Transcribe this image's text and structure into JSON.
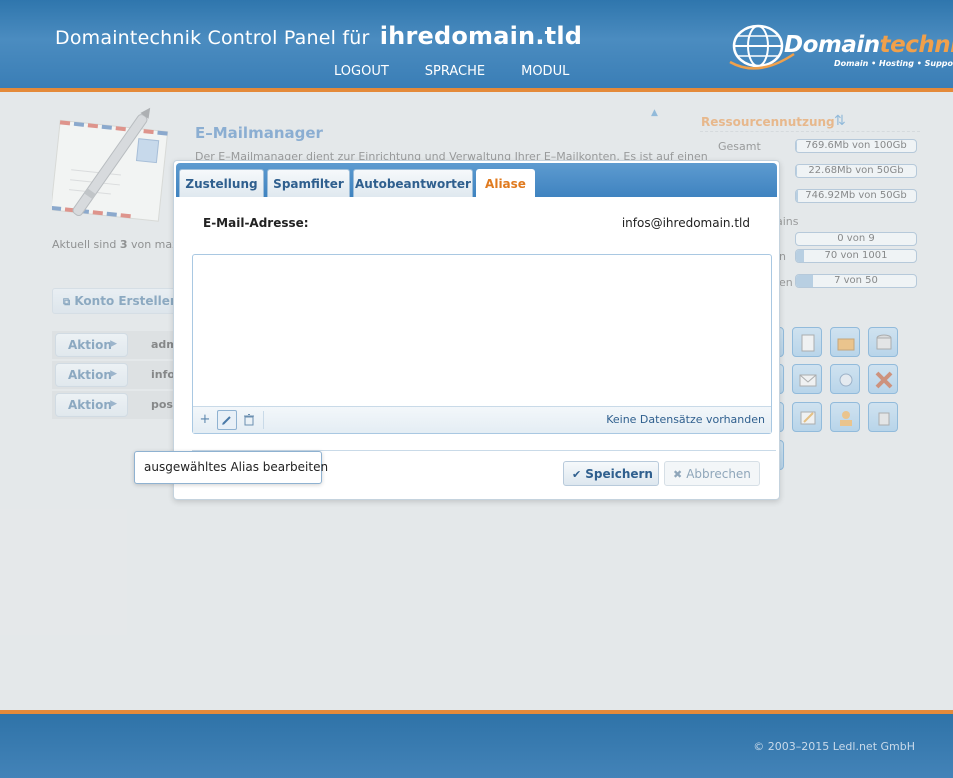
{
  "header": {
    "title_prefix": "Domaintechnik Control Panel für",
    "domain": "ihredomain.tld",
    "nav": [
      "LOGOUT",
      "SPRACHE",
      "MODUL"
    ],
    "logo": {
      "brand_a": "Domain",
      "brand_b": "technik",
      "tagline": "Domain • Hosting • Support"
    }
  },
  "page": {
    "title": "E–Mailmanager",
    "description": "Der E–Mailmanager dient zur Einrichtung und Verwaltung Ihrer E–Mailkonten. Es ist auf einen",
    "count_prefix": "Aktuell sind",
    "count_value": "3",
    "count_suffix": "von max",
    "create_button": "Konto Erstellen",
    "action_rows": [
      {
        "action": "Aktion",
        "name": "adm"
      },
      {
        "action": "Aktion",
        "name": "info"
      },
      {
        "action": "Aktion",
        "name": "post"
      }
    ]
  },
  "resources": {
    "title": "Ressourcennutzung",
    "gesamt_label": "Gesamt",
    "bars": [
      {
        "text": "769.6Mb von 100Gb",
        "fill": 0.01
      },
      {
        "text": "22.68Mb von 50Gb",
        "fill": 0.005
      },
      {
        "text": "746.92Mb von 50Gb",
        "fill": 0.015
      }
    ],
    "domain_label_fragment": "ains",
    "bars2": [
      {
        "text": "0 von 9",
        "fill": 0.0,
        "label": ""
      },
      {
        "text": "70 von 1001",
        "fill": 0.07,
        "label": "n"
      },
      {
        "text": "7 von 50",
        "fill": 0.14,
        "label": "en"
      }
    ]
  },
  "dialog": {
    "tabs": [
      "Zustellung",
      "Spamfilter",
      "Autobeantworter",
      "Aliase"
    ],
    "active_tab": "Aliase",
    "field_label": "E-Mail-Adresse:",
    "field_value": "infos@ihredomain.tld",
    "grid_empty": "Keine Datensätze vorhanden",
    "save": "Speichern",
    "cancel": "Abbrechen"
  },
  "tooltip": "ausgewähltes Alias bearbeiten",
  "footer": {
    "copyright": "© 2003–2015 Ledl.net GmbH"
  },
  "colors": {
    "accent": "#e48a3a",
    "primary": "#3f83c0",
    "link": "#3d79b8"
  }
}
